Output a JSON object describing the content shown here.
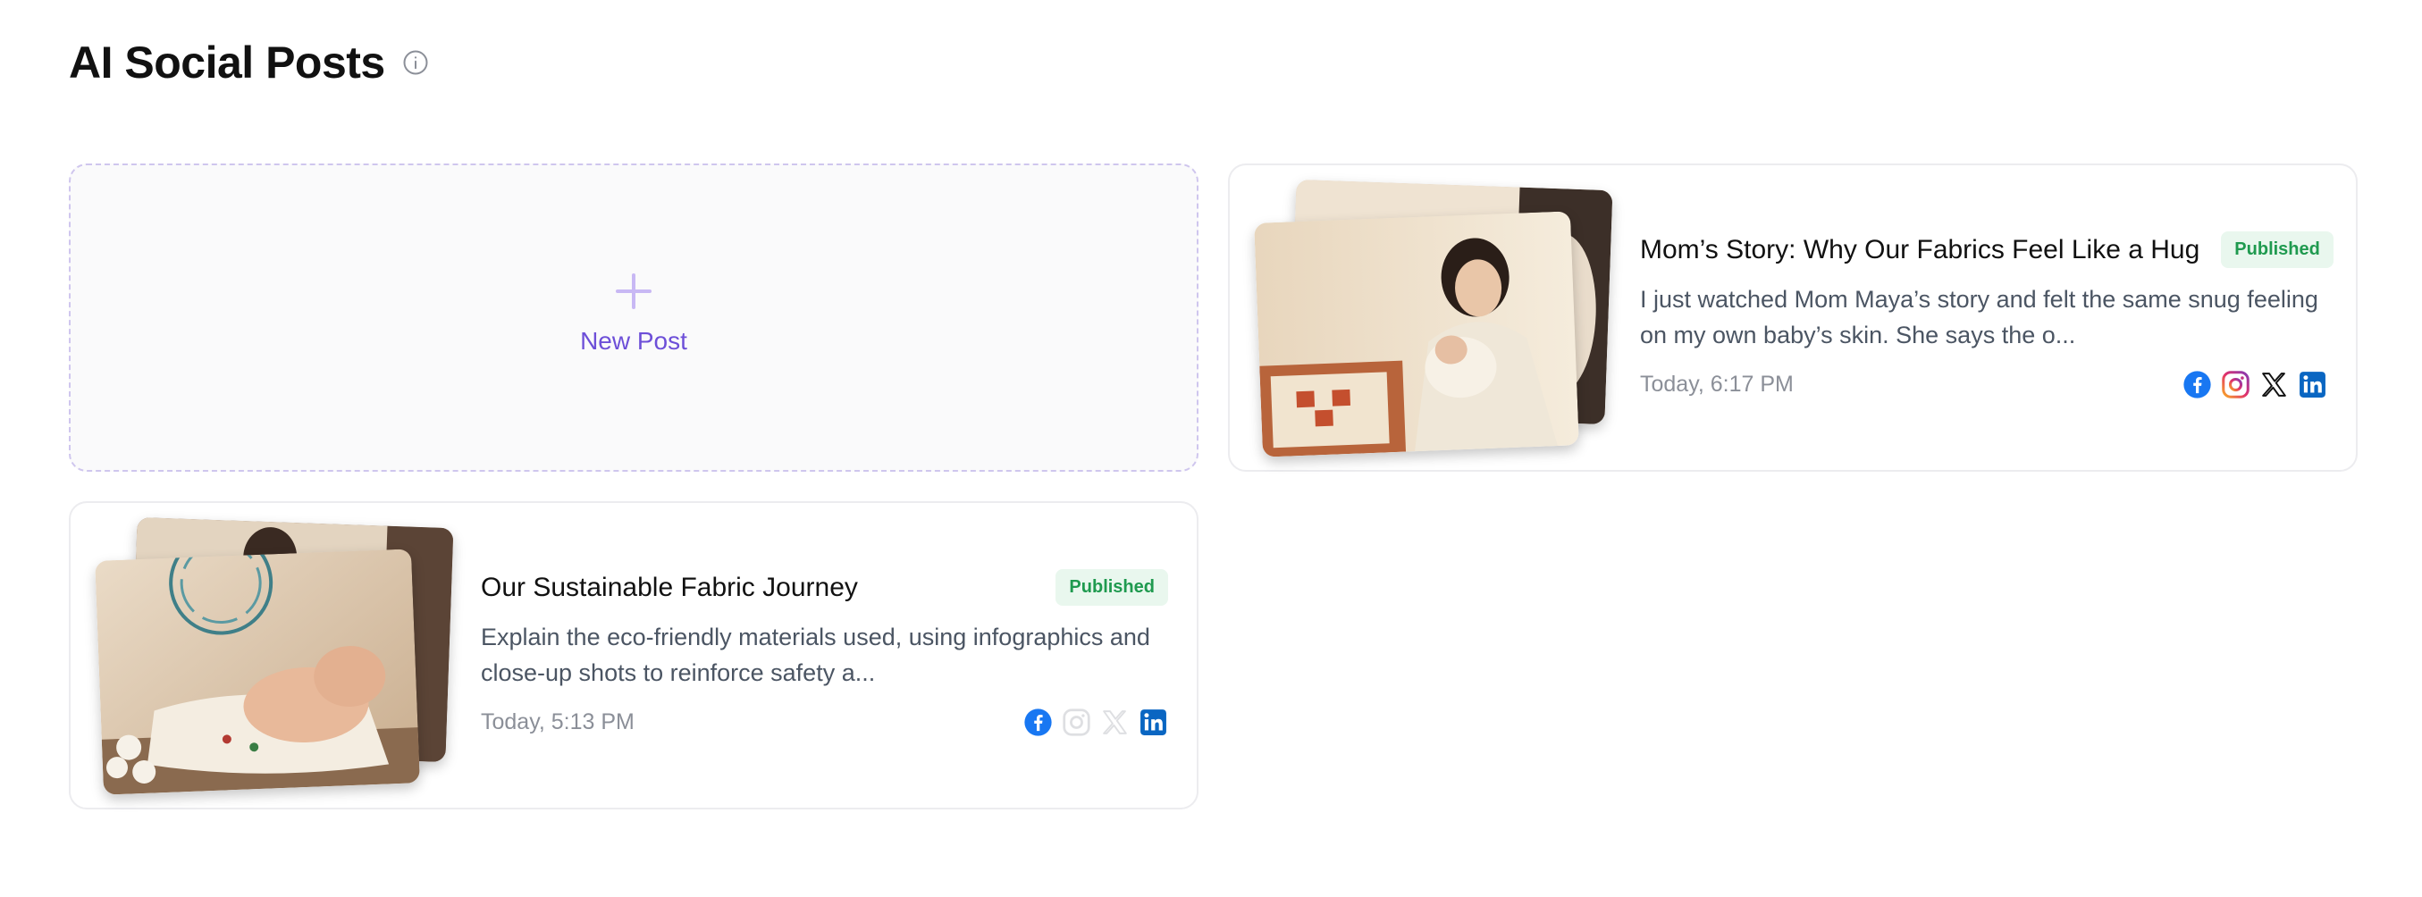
{
  "page": {
    "title": "AI Social Posts"
  },
  "new_post": {
    "label": "New Post"
  },
  "posts": [
    {
      "title": "Mom’s Story: Why Our Fabrics Feel Like a Hug",
      "status": "Published",
      "description": "I just watched Mom Maya’s story and felt the same snug feeling on my own baby’s skin. She says the o...",
      "timestamp": "Today, 6:17 PM",
      "channels": {
        "facebook": "active",
        "instagram": "active",
        "x": "active",
        "linkedin": "active"
      }
    },
    {
      "title": "Our Sustainable Fabric Journey",
      "status": "Published",
      "description": "Explain the eco-friendly materials used, using infographics and close-up shots to reinforce safety a...",
      "timestamp": "Today, 5:13 PM",
      "channels": {
        "facebook": "active",
        "instagram": "inactive",
        "x": "inactive",
        "linkedin": "active"
      }
    }
  ],
  "colors": {
    "accent": "#6d4fd8",
    "badge_bg": "#e9f7ee",
    "badge_text": "#1f9a4f",
    "facebook": "#1877f2",
    "linkedin": "#0a66c2"
  }
}
